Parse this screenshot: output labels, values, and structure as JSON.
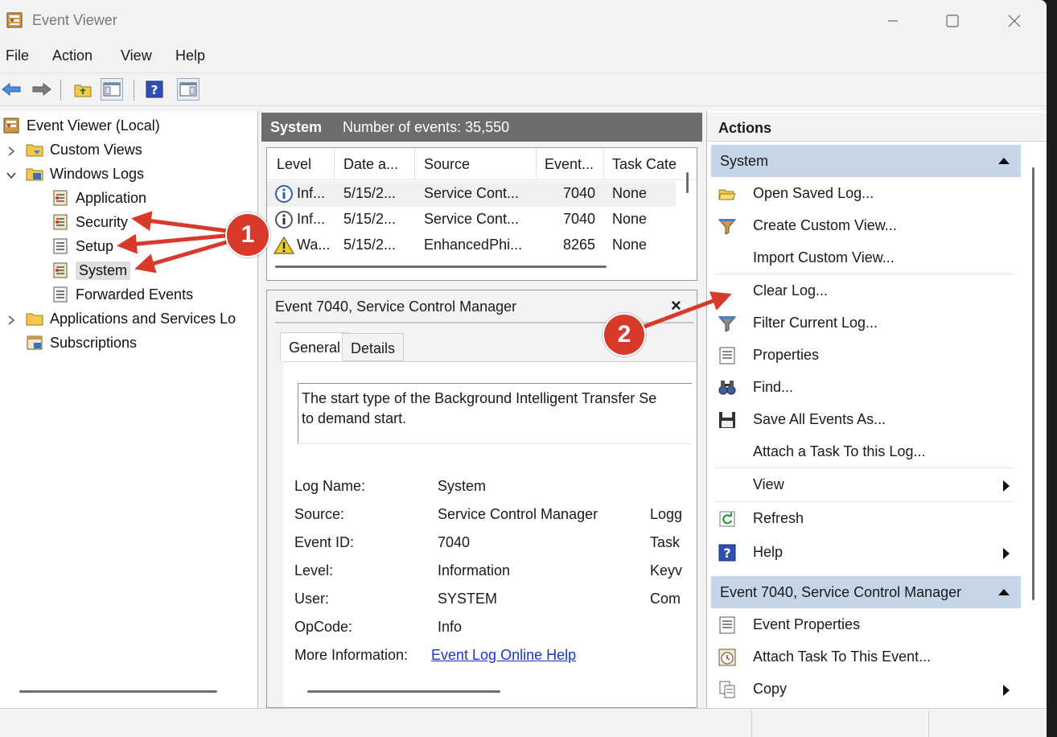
{
  "window": {
    "title": "Event Viewer"
  },
  "menu": [
    "File",
    "Action",
    "View",
    "Help"
  ],
  "tree": {
    "root": "Event Viewer (Local)",
    "custom_views": "Custom Views",
    "windows_logs": "Windows Logs",
    "application": "Application",
    "security": "Security",
    "setup": "Setup",
    "system": "System",
    "forwarded": "Forwarded Events",
    "apps_services": "Applications and Services Lo",
    "subscriptions": "Subscriptions"
  },
  "log_header": {
    "name": "System",
    "count": "Number of events: 35,550"
  },
  "grid": {
    "columns": [
      "Level",
      "Date a...",
      "Source",
      "Event...",
      "Task Cate"
    ],
    "rows": [
      {
        "level": "Inf...",
        "date": "5/15/2...",
        "source": "Service Cont...",
        "event": "7040",
        "task": "None",
        "icon": "info-icon"
      },
      {
        "level": "Inf...",
        "date": "5/15/2...",
        "source": "Service Cont...",
        "event": "7040",
        "task": "None",
        "icon": "info-icon"
      },
      {
        "level": "Wa...",
        "date": "5/15/2...",
        "source": "EnhancedPhi...",
        "event": "8265",
        "task": "None",
        "icon": "warning-icon"
      }
    ]
  },
  "detail": {
    "title": "Event 7040, Service Control Manager",
    "tabs": [
      "General",
      "Details"
    ],
    "description_line1": "The start type of the Background Intelligent Transfer Se",
    "description_line2": "to demand start.",
    "fields": {
      "log_name_label": "Log Name:",
      "log_name": "System",
      "source_label": "Source:",
      "source": "Service Control Manager",
      "source_right": "Logg",
      "event_id_label": "Event ID:",
      "event_id": "7040",
      "event_id_right": "Task",
      "level_label": "Level:",
      "level": "Information",
      "level_right": "Keyv",
      "user_label": "User:",
      "user": "SYSTEM",
      "user_right": "Com",
      "opcode_label": "OpCode:",
      "opcode": "Info",
      "more_info_label": "More Information:",
      "more_info_link": "Event Log Online Help"
    }
  },
  "actions": {
    "header": "Actions",
    "section1": "System",
    "items1": [
      {
        "label": "Open Saved Log...",
        "icon": "folder-open-icon"
      },
      {
        "label": "Create Custom View...",
        "icon": "filter-icon"
      },
      {
        "label": "Import Custom View...",
        "icon": ""
      },
      {
        "label": "Clear Log...",
        "icon": ""
      },
      {
        "label": "Filter Current Log...",
        "icon": "filter-icon"
      },
      {
        "label": "Properties",
        "icon": "properties-icon"
      },
      {
        "label": "Find...",
        "icon": "binoculars-icon"
      },
      {
        "label": "Save All Events As...",
        "icon": "save-icon"
      },
      {
        "label": "Attach a Task To this Log...",
        "icon": ""
      },
      {
        "label": "View",
        "icon": ""
      },
      {
        "label": "Refresh",
        "icon": "refresh-icon"
      },
      {
        "label": "Help",
        "icon": "help-icon"
      }
    ],
    "section2": "Event 7040, Service Control Manager",
    "items2": [
      {
        "label": "Event Properties",
        "icon": "properties-icon"
      },
      {
        "label": "Attach Task To This Event...",
        "icon": "clock-icon"
      },
      {
        "label": "Copy",
        "icon": "copy-icon"
      }
    ]
  },
  "annotations": {
    "badge1": "1",
    "badge2": "2"
  },
  "colors": {
    "accent_section": "#c7d5e8",
    "annotation_red": "#d7392b",
    "link": "#1a37c9"
  }
}
